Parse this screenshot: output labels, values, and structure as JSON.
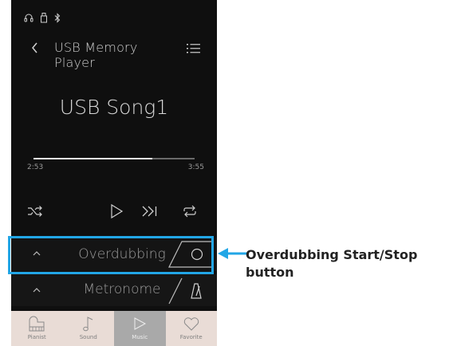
{
  "status_bar": {
    "icons": [
      "headphones-icon",
      "usb-icon",
      "bluetooth-icon"
    ]
  },
  "header": {
    "title": "USB Memory Player",
    "back_icon": "chevron-left-icon",
    "menu_icon": "list-icon"
  },
  "player": {
    "song_title": "USB Song1",
    "elapsed": "2:53",
    "duration": "3:55",
    "progress": 0.74
  },
  "controls": [
    "shuffle-icon",
    "play-icon",
    "next-track-icon",
    "repeat-icon"
  ],
  "overdubbing_bar": {
    "label": "Overdubbing",
    "expand_icon": "chevron-up-icon",
    "button_icon": "record-circle-icon"
  },
  "metronome_bar": {
    "label": "Metronome",
    "expand_icon": "chevron-up-icon",
    "button_icon": "metronome-icon"
  },
  "bottom_nav": {
    "items": [
      {
        "label": "Pianist",
        "icon": "piano-icon",
        "active": false
      },
      {
        "label": "Sound",
        "icon": "music-note-icon",
        "active": false
      },
      {
        "label": "Music",
        "icon": "play-icon",
        "active": true
      },
      {
        "label": "Favorite",
        "icon": "heart-icon",
        "active": false
      }
    ]
  },
  "callout": {
    "text_line1": "Overdubbing Start/Stop",
    "text_line2": "button",
    "color": "#22a6e6"
  }
}
